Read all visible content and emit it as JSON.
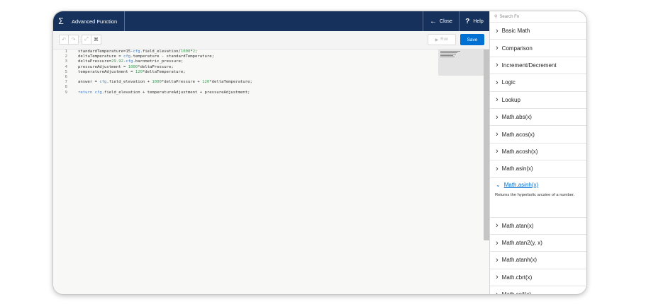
{
  "header": {
    "icon": "sigma-icon",
    "title": "Advanced Function",
    "close_label": "Close",
    "help_label": "Help"
  },
  "toolbar": {
    "run_label": "Run",
    "save_label": "Save"
  },
  "editor": {
    "lines": [
      {
        "n": "1",
        "segments": [
          [
            "plain",
            "standardTemperature=15-"
          ],
          [
            "prop",
            "cfg"
          ],
          [
            "plain",
            ".field_elevation/"
          ],
          [
            "num",
            "1000"
          ],
          [
            "plain",
            "*"
          ],
          [
            "num",
            "2"
          ],
          [
            "plain",
            ";"
          ]
        ]
      },
      {
        "n": "2",
        "segments": [
          [
            "plain",
            "deltaTemperature = "
          ],
          [
            "prop",
            "cfg"
          ],
          [
            "plain",
            ".temperature - standardTemperature;"
          ]
        ]
      },
      {
        "n": "3",
        "segments": [
          [
            "plain",
            "deltaPressure="
          ],
          [
            "num",
            "29.92"
          ],
          [
            "plain",
            "-"
          ],
          [
            "prop",
            "cfg"
          ],
          [
            "plain",
            ".barometric_pressure;"
          ]
        ]
      },
      {
        "n": "4",
        "segments": [
          [
            "plain",
            "pressureAdjustment = "
          ],
          [
            "num",
            "1000"
          ],
          [
            "plain",
            "*deltaPressure;"
          ]
        ]
      },
      {
        "n": "5",
        "segments": [
          [
            "plain",
            "temperatureAdjustment = "
          ],
          [
            "num",
            "120"
          ],
          [
            "plain",
            "*deltaTemperature;"
          ]
        ]
      },
      {
        "n": "6",
        "segments": []
      },
      {
        "n": "7",
        "segments": [
          [
            "plain",
            "answer = "
          ],
          [
            "prop",
            "cfg"
          ],
          [
            "plain",
            ".field_elevation + "
          ],
          [
            "num",
            "1000"
          ],
          [
            "plain",
            "*deltaPressure + "
          ],
          [
            "num",
            "120"
          ],
          [
            "plain",
            "*deltaTemperature;"
          ]
        ]
      },
      {
        "n": "8",
        "segments": []
      },
      {
        "n": "9",
        "segments": [
          [
            "kw",
            "return "
          ],
          [
            "prop",
            "cfg"
          ],
          [
            "plain",
            ".field_elevation + temperatureAdjustment + pressureAdjustment;"
          ]
        ]
      }
    ]
  },
  "panel": {
    "search_placeholder": "Search Fn",
    "items_before": [
      "Basic Math",
      "Comparison",
      "Increment/Decrement",
      "Logic",
      "Lookup",
      "Math.abs(x)",
      "Math.acos(x)",
      "Math.acosh(x)",
      "Math.asin(x)"
    ],
    "expanded_item": "Math.asinh(x)",
    "expanded_desc": "Returns the hyperbolic arcsine of a number.",
    "items_after": [
      "Math.atan(x)",
      "Math.atan2(y, x)",
      "Math.atanh(x)",
      "Math.cbrt(x)",
      "Math.ceil(x)"
    ]
  },
  "colors": {
    "header_bg": "#16325c",
    "save_bg": "#0070d2",
    "link": "#0070d2"
  }
}
